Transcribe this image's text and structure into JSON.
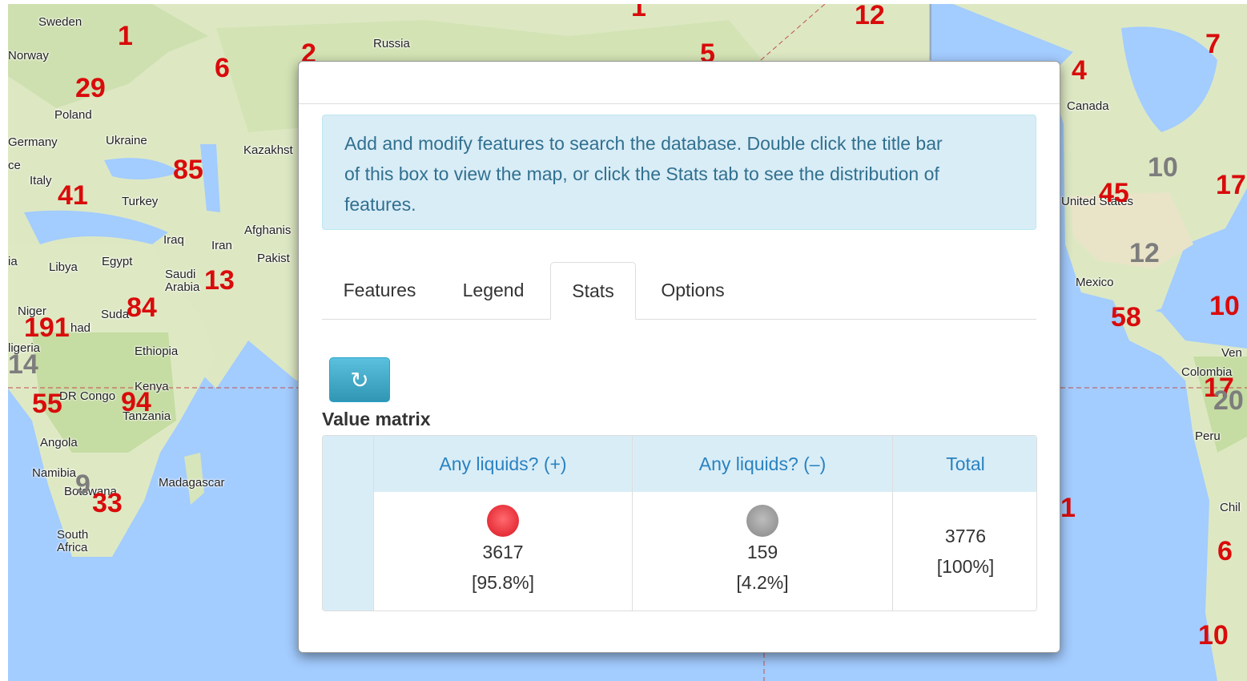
{
  "map": {
    "countries": [
      {
        "name": "Sweden"
      },
      {
        "name": "Norway"
      },
      {
        "name": "Poland"
      },
      {
        "name": "Germany"
      },
      {
        "name": "Ukraine"
      },
      {
        "name": "ce"
      },
      {
        "name": "Italy"
      },
      {
        "name": "Turkey"
      },
      {
        "name": "Kazakhst"
      },
      {
        "name": "Russia"
      },
      {
        "name": "Iraq"
      },
      {
        "name": "Iran"
      },
      {
        "name": "Afghanis"
      },
      {
        "name": "Pakist"
      },
      {
        "name": "ia"
      },
      {
        "name": "Libya"
      },
      {
        "name": "Egypt"
      },
      {
        "name": "Saudi\nArabia"
      },
      {
        "name": "Niger"
      },
      {
        "name": "Suda"
      },
      {
        "name": "had"
      },
      {
        "name": "ligeria"
      },
      {
        "name": "Ethiopia"
      },
      {
        "name": "Kenya"
      },
      {
        "name": "DR Congo"
      },
      {
        "name": "Tanzania"
      },
      {
        "name": "Angola"
      },
      {
        "name": "Namibia"
      },
      {
        "name": "Botswana"
      },
      {
        "name": "Madagascar"
      },
      {
        "name": "South\nAfrica"
      },
      {
        "name": "Canada"
      },
      {
        "name": "United States"
      },
      {
        "name": "Mexico"
      },
      {
        "name": "Colombia"
      },
      {
        "name": "Ven"
      },
      {
        "name": "Peru"
      },
      {
        "name": "Chil"
      }
    ],
    "markers": [
      {
        "label": "1",
        "color": "red"
      },
      {
        "label": "29",
        "color": "red"
      },
      {
        "label": "6",
        "color": "red"
      },
      {
        "label": "2",
        "color": "red"
      },
      {
        "label": "1",
        "color": "red"
      },
      {
        "label": "12",
        "color": "red"
      },
      {
        "label": "5",
        "color": "red"
      },
      {
        "label": "7",
        "color": "red"
      },
      {
        "label": "4",
        "color": "red"
      },
      {
        "label": "85",
        "color": "red"
      },
      {
        "label": "41",
        "color": "red"
      },
      {
        "label": "13",
        "color": "red"
      },
      {
        "label": "10",
        "color": "grey"
      },
      {
        "label": "45",
        "color": "red"
      },
      {
        "label": "17",
        "color": "red"
      },
      {
        "label": "12",
        "color": "grey"
      },
      {
        "label": "84",
        "color": "red"
      },
      {
        "label": "191",
        "color": "red"
      },
      {
        "label": "58",
        "color": "red"
      },
      {
        "label": "10",
        "color": "red"
      },
      {
        "label": "14",
        "color": "grey"
      },
      {
        "label": "55",
        "color": "red"
      },
      {
        "label": "94",
        "color": "red"
      },
      {
        "label": "17",
        "color": "red"
      },
      {
        "label": "20",
        "color": "grey"
      },
      {
        "label": "9",
        "color": "grey"
      },
      {
        "label": "33",
        "color": "red"
      },
      {
        "label": "1",
        "color": "red"
      },
      {
        "label": "6",
        "color": "red"
      },
      {
        "label": "10",
        "color": "red"
      }
    ]
  },
  "modal": {
    "info_text": "Add and modify features to search the database. Double click the title bar of this box to view the map, or click the Stats tab to see the distribution of features.",
    "tabs": [
      {
        "label": "Features",
        "active": false
      },
      {
        "label": "Legend",
        "active": false
      },
      {
        "label": "Stats",
        "active": true
      },
      {
        "label": "Options",
        "active": false
      }
    ],
    "refresh_icon": "refresh-icon",
    "matrix_title": "Value matrix",
    "matrix": {
      "headers": [
        "Any liquids? (+)",
        "Any liquids? (–)",
        "Total"
      ],
      "cells": [
        {
          "count": "3617",
          "percent": "[95.8%]",
          "dot_color": "#e8323c"
        },
        {
          "count": "159",
          "percent": "[4.2%]",
          "dot_color": "#999999"
        },
        {
          "count": "3776",
          "percent": "[100%]"
        }
      ]
    }
  },
  "colors": {
    "ocean": "#a3ccff",
    "land": "#dfe9c8",
    "marker_red": "#d90b0b",
    "marker_grey": "#7d7d7d",
    "info_bg": "#d9edf7",
    "info_text": "#31708f",
    "button": "#31b0d5"
  }
}
